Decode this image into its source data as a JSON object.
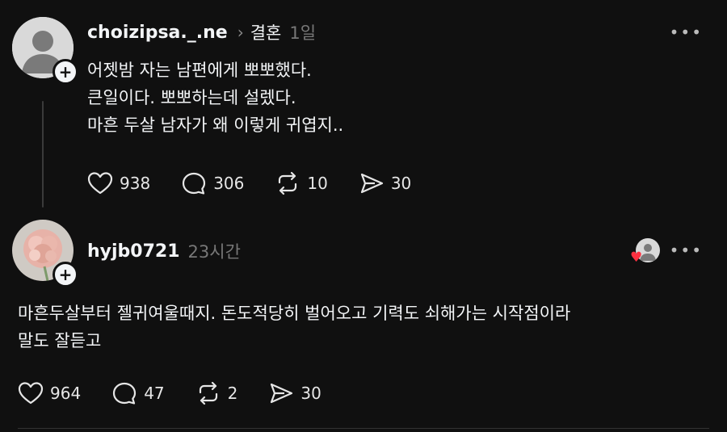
{
  "post1": {
    "username": "choizipsa._.ne",
    "chevron": "›",
    "community": "결혼",
    "time": "1일",
    "more": "•••",
    "plus": "+",
    "lines": [
      "어젯밤 자는 남편에게 뽀뽀했다.",
      "큰일이다. 뽀뽀하는데 설렜다.",
      "마흔 두살 남자가 왜 이렇게 귀엽지.."
    ],
    "likes": "938",
    "replies": "306",
    "reposts": "10",
    "shares": "30"
  },
  "post2": {
    "username": "hyjb0721",
    "time": "23시간",
    "more": "•••",
    "plus": "+",
    "liked_badge": "♥",
    "lines": [
      "마흔두살부터 젤귀여울때지. 돈도적당히 벌어오고 기력도 쇠해가는 시작점이라",
      "말도 잘듣고"
    ],
    "likes": "964",
    "replies": "47",
    "reposts": "2",
    "shares": "30"
  },
  "icons": {
    "like": "heart-icon",
    "reply": "comment-icon",
    "repost": "repost-icon",
    "share": "send-icon",
    "more": "more-icon"
  },
  "colors": {
    "background": "#101010",
    "text": "#f3f5f7",
    "muted": "#777777",
    "heart": "#ff3040"
  }
}
